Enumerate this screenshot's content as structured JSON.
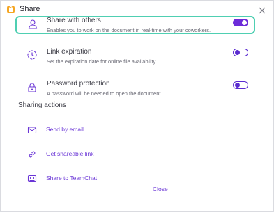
{
  "dialog": {
    "title": "Share",
    "close_icon": "close-icon",
    "app_icon": "app-logo-icon"
  },
  "options": [
    {
      "title": "Share with others",
      "description": "Enables you to work on the document in real-time with your coworkers.",
      "icon": "share-users-icon",
      "toggle_on": true
    },
    {
      "title": "Link expiration",
      "description": "Set the expiration date for online file availability.",
      "icon": "clock-icon",
      "toggle_on": false
    },
    {
      "title": "Password protection",
      "description": "A password will be needed to open the document.",
      "icon": "lock-icon",
      "toggle_on": false
    }
  ],
  "sharing_actions": {
    "title": "Sharing actions",
    "items": [
      {
        "label": "Send by email",
        "icon": "email-icon"
      },
      {
        "label": "Get shareable link",
        "icon": "link-icon"
      },
      {
        "label": "Share to TeamChat",
        "icon": "teamchat-icon"
      }
    ]
  },
  "footer": {
    "close_label": "Close"
  },
  "colors": {
    "accent": "#6c2bd9",
    "highlight_border": "#4fcfb2",
    "app_icon": "#f5a623"
  }
}
